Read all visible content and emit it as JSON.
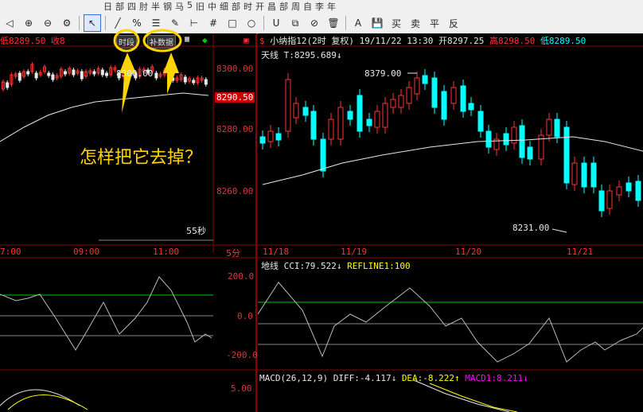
{
  "toolbar": {
    "row1_items": [
      "日",
      "部",
      "四",
      "肘",
      "半",
      "钢",
      "马",
      "5",
      "旧",
      "中",
      "细",
      "部",
      "时",
      "开",
      "昌",
      "部",
      "周",
      "自",
      "李",
      "年"
    ],
    "buttons": [
      {
        "name": "arrow-left-icon",
        "glyph": "◁"
      },
      {
        "name": "zoom-in-icon",
        "glyph": "⊕"
      },
      {
        "name": "zoom-out-icon",
        "glyph": "⊖"
      },
      {
        "name": "gear-icon",
        "glyph": "⚙"
      },
      {
        "name": "cursor-icon",
        "glyph": "↖"
      },
      {
        "name": "line-tool-icon",
        "glyph": "╱"
      },
      {
        "name": "fibonacci-icon",
        "glyph": "%"
      },
      {
        "name": "channel-icon",
        "glyph": "☰"
      },
      {
        "name": "pen-icon",
        "glyph": "✎"
      },
      {
        "name": "bracket-icon",
        "glyph": "⊢"
      },
      {
        "name": "grid-icon",
        "glyph": "#"
      },
      {
        "name": "rectangle-icon",
        "glyph": "□"
      },
      {
        "name": "circle-icon",
        "glyph": "○"
      },
      {
        "name": "magnet-icon",
        "glyph": "U"
      },
      {
        "name": "copy-icon",
        "glyph": "⧉"
      },
      {
        "name": "lock-icon",
        "glyph": "⊘"
      },
      {
        "name": "trash-icon",
        "glyph": "🗑"
      },
      {
        "name": "text-color-icon",
        "glyph": "A"
      },
      {
        "name": "save-icon",
        "glyph": "💾"
      }
    ],
    "trade_buttons": [
      "买",
      "卖",
      "平",
      "反"
    ]
  },
  "left_panel": {
    "header_low": "低8289.50",
    "header_close": "收8",
    "badge_time": "时段",
    "badge_fill": "补数据",
    "peak_label": "8300.00",
    "price_tag": "8290.50",
    "seconds": "55秒",
    "y_ticks": [
      "8300.00",
      "8280.00",
      "8260.00"
    ],
    "x_ticks": [
      "7:00",
      "09:00",
      "11:00"
    ],
    "period": "5分",
    "ind_ticks": [
      "200.0",
      "0.0",
      "-200.0"
    ],
    "macd_tick": "5.00"
  },
  "annotation": "怎样把它去掉？",
  "right_panel": {
    "title_symbol": "小纳指12(2时 复权)",
    "title_date": "19/11/22 13:30",
    "title_open": "开8297.25",
    "title_high": "高8298.50",
    "title_low": "低8289.50",
    "line_label": "天线 T:8295.689↓",
    "high_label": "8379.00",
    "low_label": "8231.00",
    "x_ticks": [
      "11/18",
      "11/19",
      "11/20",
      "11/21"
    ],
    "cci_title": "地线 CCI:79.522↓",
    "cci_ref": "REFLINE1:100",
    "macd_title": "MACD(26,12,9) DIFF:-4.117↓",
    "macd_dea": "DEA:-8.222↑",
    "macd_macd1": "MACD1:8.211↓"
  },
  "colors": {
    "up": "#ff3232",
    "down": "#00ffff",
    "accent": "#ffd400"
  }
}
